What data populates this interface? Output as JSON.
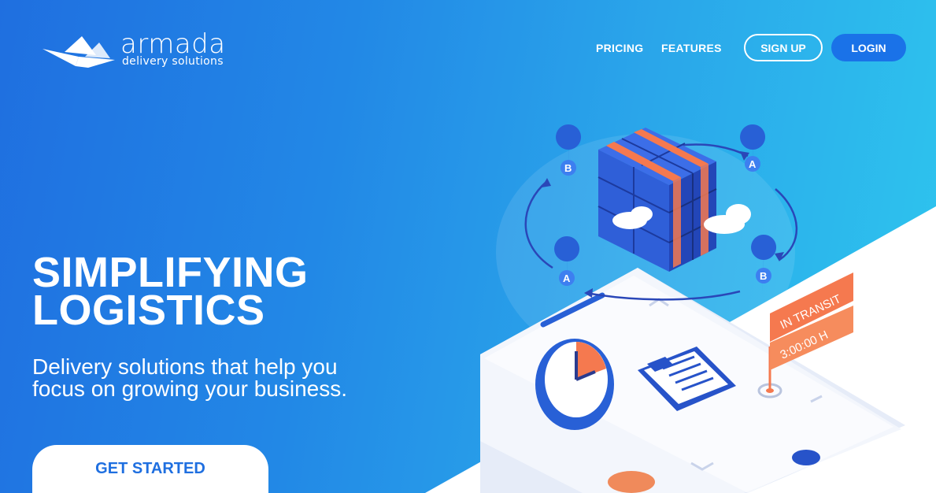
{
  "brand": {
    "name": "armada",
    "tagline": "delivery solutions",
    "logo_icon": "paper-boat-icon"
  },
  "nav": {
    "links": [
      {
        "label": "PRICING"
      },
      {
        "label": "FEATURES"
      }
    ],
    "signup_label": "SIGN UP",
    "login_label": "LOGIN"
  },
  "hero": {
    "headline_line1": "SIMPLIFYING",
    "headline_line2": "LOGISTICS",
    "subtitle": "Delivery solutions that help you focus on growing your business.",
    "cta_label": "GET STARTED"
  },
  "illustration": {
    "pins": [
      "B",
      "A",
      "A",
      "B"
    ],
    "status_tag": "IN TRANSIT",
    "time_tag": "3:00:00 H"
  },
  "colors": {
    "gradient_start": "#1f6fe0",
    "gradient_end": "#2ec6ee",
    "login_button": "#1a72e8",
    "cta_text": "#1f6fe0",
    "tag_orange": "#f5794f"
  }
}
